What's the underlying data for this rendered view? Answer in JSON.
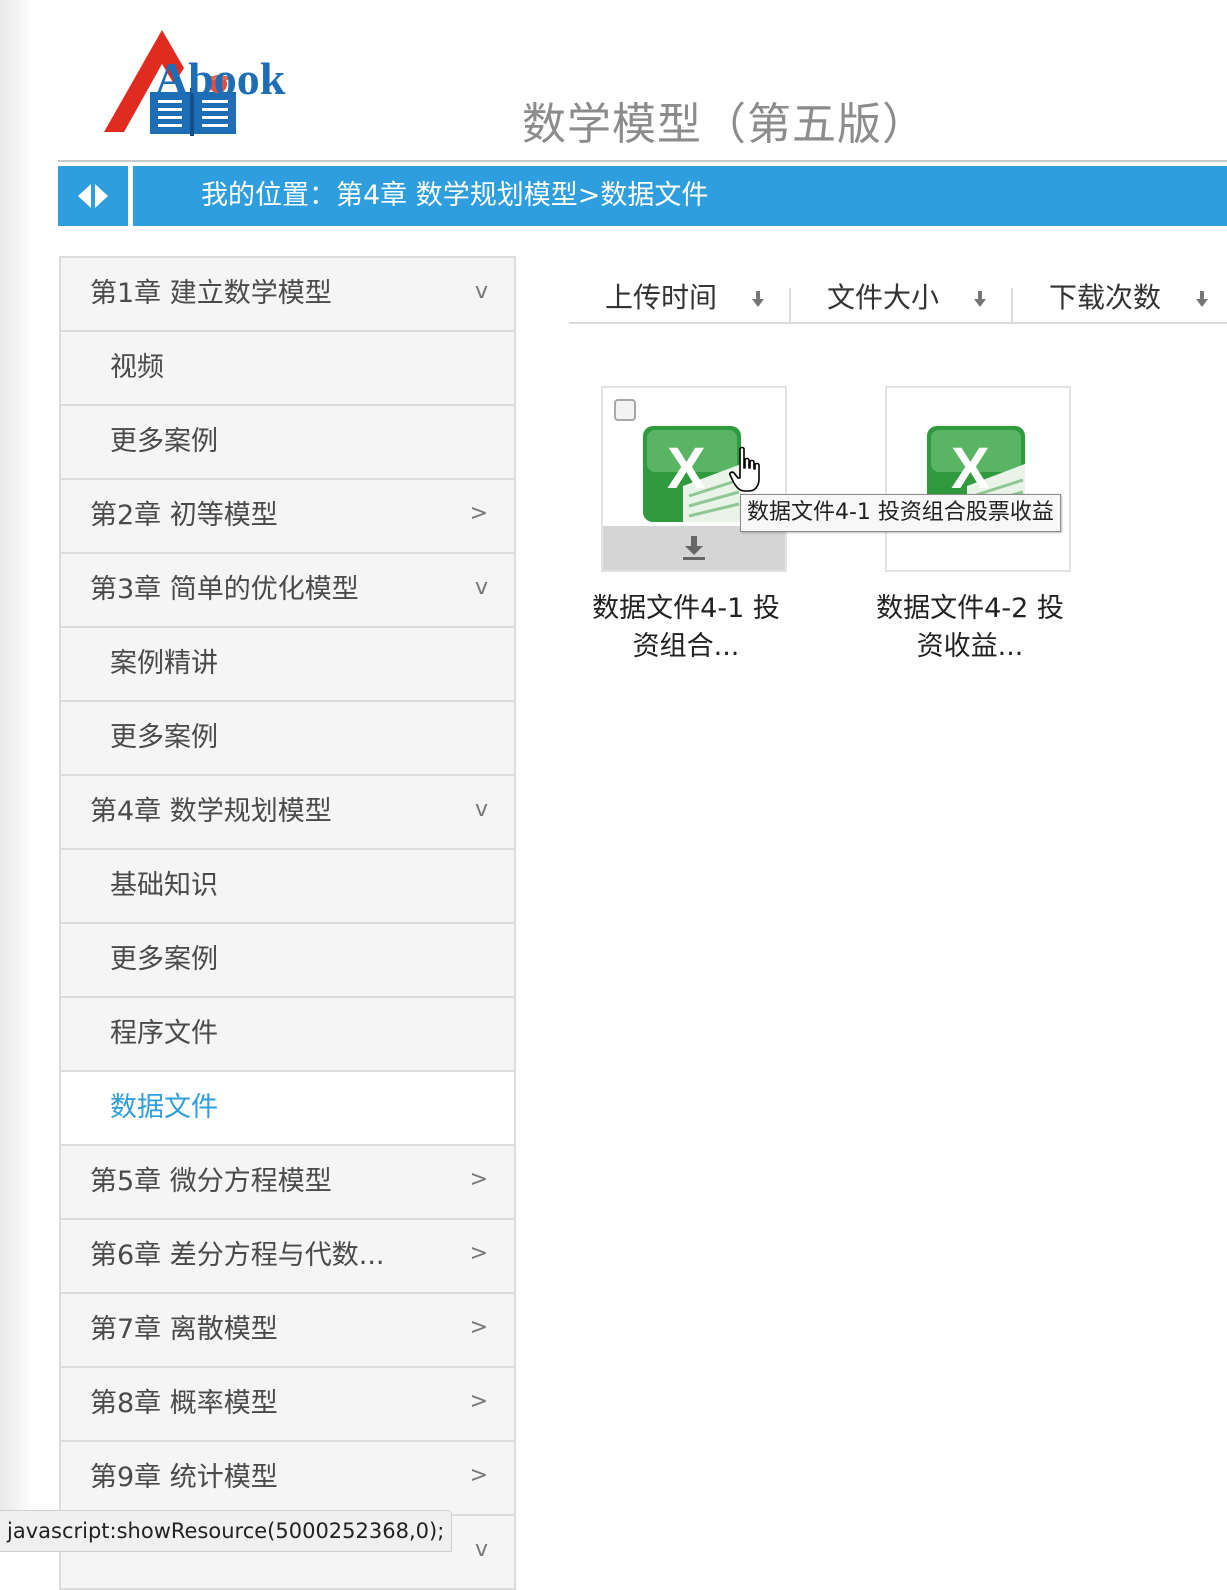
{
  "site": {
    "logo_text": "Abook",
    "book_title": "数学模型（第五版）"
  },
  "breadcrumb": {
    "text": "我的位置：第4章 数学规划模型>数据文件"
  },
  "sidebar": {
    "items": [
      {
        "label": "第1章 建立数学模型",
        "type": "chapter",
        "chevron": "v"
      },
      {
        "label": "视频",
        "type": "sub"
      },
      {
        "label": "更多案例",
        "type": "sub"
      },
      {
        "label": "第2章 初等模型",
        "type": "chapter",
        "chevron": ">"
      },
      {
        "label": "第3章 简单的优化模型",
        "type": "chapter",
        "chevron": "v"
      },
      {
        "label": "案例精讲",
        "type": "sub"
      },
      {
        "label": "更多案例",
        "type": "sub"
      },
      {
        "label": "第4章 数学规划模型",
        "type": "chapter",
        "chevron": "v"
      },
      {
        "label": "基础知识",
        "type": "sub"
      },
      {
        "label": "更多案例",
        "type": "sub"
      },
      {
        "label": "程序文件",
        "type": "sub"
      },
      {
        "label": "数据文件",
        "type": "sub",
        "active": true
      },
      {
        "label": "第5章 微分方程模型",
        "type": "chapter",
        "chevron": ">"
      },
      {
        "label": "第6章 差分方程与代数...",
        "type": "chapter",
        "chevron": ">"
      },
      {
        "label": "第7章 离散模型",
        "type": "chapter",
        "chevron": ">"
      },
      {
        "label": "第8章 概率模型",
        "type": "chapter",
        "chevron": ">"
      },
      {
        "label": "第9章 统计模型",
        "type": "chapter",
        "chevron": ">"
      },
      {
        "label": "",
        "type": "chapter",
        "chevron": "v"
      }
    ]
  },
  "sort": {
    "upload_time": "上传时间",
    "file_size": "文件大小",
    "download_count": "下载次数"
  },
  "files": [
    {
      "caption_line1": "数据文件4-1 投",
      "caption_line2": "资组合...",
      "icon": "excel-icon"
    },
    {
      "caption_line1": "数据文件4-2 投",
      "caption_line2": "资收益...",
      "icon": "excel-icon"
    }
  ],
  "tooltip": "数据文件4-1 投资组合股票收益",
  "status_url": "javascript:showResource(5000252368,0);",
  "colors": {
    "accent": "#2e9ede",
    "logo_red": "#e02b20",
    "logo_blue": "#1d6eb7",
    "excel_green": "#2f9a3e"
  }
}
